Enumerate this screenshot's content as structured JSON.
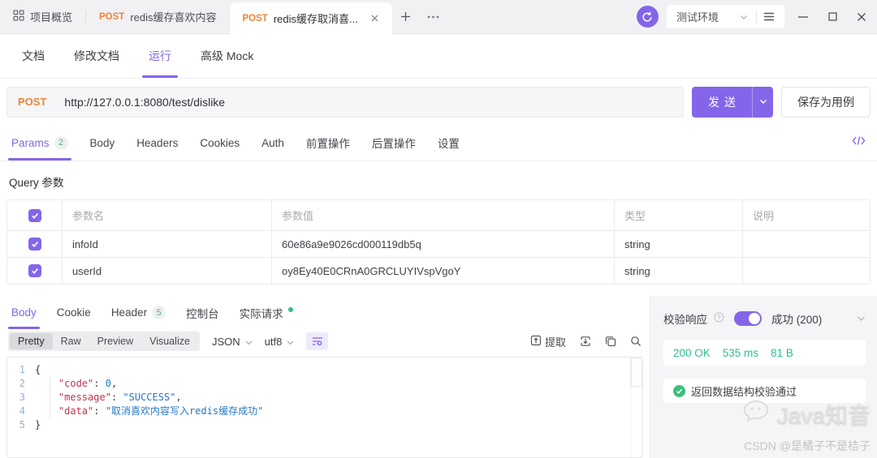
{
  "colors": {
    "accent": "#8465ea",
    "method_orange": "#ef8336",
    "success_green": "#2fbe8f"
  },
  "titlebar": {
    "overview_label": "项目概览",
    "tab1": {
      "method": "POST",
      "title": "redis缓存喜欢内容"
    },
    "tab2": {
      "method": "POST",
      "title": "redis缓存取消喜..."
    },
    "env_label": "测试环境"
  },
  "nav": {
    "tabs": [
      "文档",
      "修改文档",
      "运行",
      "高级 Mock"
    ],
    "active": "运行"
  },
  "request": {
    "method": "POST",
    "url": "http://127.0.0.1:8080/test/dislike",
    "send": "发送",
    "save": "保存为用例"
  },
  "request_tabs": {
    "params": "Params",
    "params_count": "2",
    "body": "Body",
    "headers": "Headers",
    "cookies": "Cookies",
    "auth": "Auth",
    "pre": "前置操作",
    "post": "后置操作",
    "settings": "设置"
  },
  "query": {
    "title": "Query 参数",
    "columns": {
      "name": "参数名",
      "value": "参数值",
      "type": "类型",
      "desc": "说明"
    },
    "rows": [
      {
        "name": "infoId",
        "value": "60e86a9e9026cd000119db5q",
        "type": "string",
        "desc": ""
      },
      {
        "name": "userId",
        "value": "oy8Ey40E0CRnA0GRCLUYIVspVgoY",
        "type": "string",
        "desc": ""
      }
    ]
  },
  "response": {
    "tabs": {
      "body": "Body",
      "cookie": "Cookie",
      "header": "Header",
      "header_count": "5",
      "console": "控制台",
      "actual": "实际请求"
    },
    "toolbar": {
      "pretty": "Pretty",
      "raw": "Raw",
      "preview": "Preview",
      "visualize": "Visualize",
      "format": "JSON",
      "encoding": "utf8",
      "extract": "提取"
    },
    "code": {
      "lines": [
        {
          "num": "1",
          "tokens": [
            {
              "text": "{",
              "type": "punct"
            }
          ]
        },
        {
          "num": "2",
          "tokens": [
            {
              "text": "    ",
              "type": "ws"
            },
            {
              "text": "\"code\"",
              "type": "key"
            },
            {
              "text": ": ",
              "type": "punct"
            },
            {
              "text": "0",
              "type": "num"
            },
            {
              "text": ",",
              "type": "punct"
            }
          ]
        },
        {
          "num": "3",
          "tokens": [
            {
              "text": "    ",
              "type": "ws"
            },
            {
              "text": "\"message\"",
              "type": "key"
            },
            {
              "text": ": ",
              "type": "punct"
            },
            {
              "text": "\"SUCCESS\"",
              "type": "str"
            },
            {
              "text": ",",
              "type": "punct"
            }
          ]
        },
        {
          "num": "4",
          "tokens": [
            {
              "text": "    ",
              "type": "ws"
            },
            {
              "text": "\"data\"",
              "type": "key"
            },
            {
              "text": ": ",
              "type": "punct"
            },
            {
              "text": "\"取消喜欢内容写入redis缓存成功\"",
              "type": "str"
            }
          ]
        },
        {
          "num": "5",
          "tokens": [
            {
              "text": "}",
              "type": "punct"
            }
          ]
        }
      ]
    }
  },
  "validation": {
    "label": "校验响应",
    "status": "成功 (200)",
    "http_status": "200 OK",
    "time": "535 ms",
    "size": "81 B",
    "schema_message": "返回数据结构校验通过"
  },
  "watermark": {
    "brand": "Java知音",
    "credit": "CSDN @是橘子不是桔子"
  }
}
